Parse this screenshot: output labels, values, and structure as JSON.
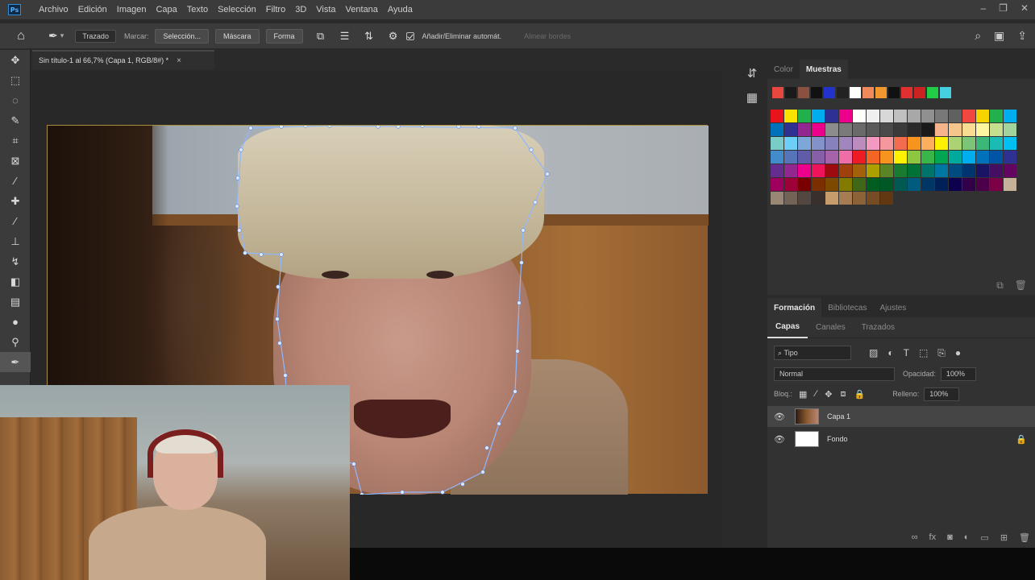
{
  "app": {
    "logo": "Ps",
    "menu": [
      "Archivo",
      "Edición",
      "Imagen",
      "Capa",
      "Texto",
      "Selección",
      "Filtro",
      "3D",
      "Vista",
      "Ventana",
      "Ayuda"
    ]
  },
  "options": {
    "mode": "Trazado",
    "make_label": "Marcar:",
    "selection_btn": "Selección...",
    "mask_btn": "Máscara",
    "shape_btn": "Forma",
    "auto_label": "Añadir/Eliminar automát.",
    "align_edges": "Alinear bordes"
  },
  "document": {
    "tab_title": "Sin título-1 al 66,7% (Capa 1, RGB/8#) *",
    "close": "×"
  },
  "tools": [
    "move-icon",
    "marquee-icon",
    "lasso-icon",
    "quick-select-icon",
    "crop-icon",
    "frame-icon",
    "eyedropper-icon",
    "healing-icon",
    "brush-icon",
    "stamp-icon",
    "history-brush-icon",
    "eraser-icon",
    "gradient-icon",
    "blur-icon",
    "dodge-icon",
    "pen-icon"
  ],
  "swatches": {
    "tabs": [
      "Color",
      "Muestras"
    ],
    "active_tab": "Muestras",
    "recent": [
      "#e8473f",
      "#1a1a1a",
      "#8a5040",
      "#111111",
      "#2233cc",
      "#222222",
      "#ffffff",
      "#f08a5a",
      "#f2962e",
      "#111111",
      "#e23030",
      "#cc2222",
      "#22cc44",
      "#44d0e0"
    ],
    "grid": [
      [
        "#e8131b",
        "#f7e200",
        "#22b04c",
        "#00aeef",
        "#2e3192",
        "#ec008c",
        "#ffffff",
        "#f0f0f0",
        "#d8d8d8",
        "#c0c0c0",
        "#a8a8a8",
        "#909090",
        "#787878",
        "#606060",
        "#f0483e",
        "#f7d300",
        "#22b04c",
        "#00aeef"
      ],
      [
        "#0072bc",
        "#2e3192",
        "#92278f",
        "#ec008c",
        "#8c8c8c",
        "#7a7a7a",
        "#6a6a6a",
        "#5a5a5a",
        "#4a4a4a",
        "#3a3a3a",
        "#2a2a2a",
        "#1a1a1a",
        "#f5b48c",
        "#f6c58c",
        "#f9dc92",
        "#fdf5a0",
        "#c6df8f",
        "#a3d39c"
      ],
      [
        "#7accc8",
        "#6dcff6",
        "#7da7d9",
        "#8393ca",
        "#8781bd",
        "#a186be",
        "#bd8cbf",
        "#f49ac1",
        "#f5989d",
        "#f26c4f",
        "#f7941d",
        "#fbaf5d",
        "#fff200",
        "#acd373",
        "#7cc576",
        "#3bb878",
        "#1abbb4",
        "#00bff3"
      ],
      [
        "#438ccb",
        "#5574b9",
        "#605ca8",
        "#855fa8",
        "#a763a9",
        "#ef6ea8",
        "#ed1c24",
        "#f26522",
        "#f7941d",
        "#fff200",
        "#8dc63f",
        "#39b54a",
        "#00a651",
        "#00a99d",
        "#00aeef",
        "#0072bc",
        "#0054a6",
        "#2e3192"
      ],
      [
        "#662d91",
        "#92278f",
        "#ec008c",
        "#ed145b",
        "#9e0b0f",
        "#a0410d",
        "#a36209",
        "#aba000",
        "#598527",
        "#197b30",
        "#007236",
        "#00746b",
        "#0076a3",
        "#004b80",
        "#003471",
        "#1b1464",
        "#440e62",
        "#630460"
      ],
      [
        "#9e005d",
        "#9e0039",
        "#790000",
        "#7b2e00",
        "#7d4900",
        "#827b00",
        "#406618",
        "#005e20",
        "#005826",
        "#005952",
        "#005b7f",
        "#003663",
        "#002157",
        "#0d004c",
        "#32004b",
        "#4b0049",
        "#7b0046",
        "#c7b299"
      ],
      [
        "#998675",
        "#736357",
        "#534741",
        "#37302d",
        "#c69c6d",
        "#a67c52",
        "#8c6239",
        "#754c24",
        "#603913"
      ]
    ]
  },
  "layers": {
    "group_tabs": [
      "Formación",
      "Bibliotecas",
      "Ajustes"
    ],
    "tabs": [
      "Capas",
      "Canales",
      "Trazados"
    ],
    "filter_label": "Tipo",
    "blend_mode": "Normal",
    "opacity_label": "Opacidad:",
    "opacity_value": "100%",
    "lock_label": "Bloq.:",
    "fill_label": "Relleno:",
    "fill_value": "100%",
    "items": [
      {
        "name": "Capa 1",
        "selected": true,
        "thumb": "#5a3a28"
      },
      {
        "name": "Fondo",
        "selected": false,
        "thumb": "#ffffff",
        "locked": true
      }
    ]
  }
}
